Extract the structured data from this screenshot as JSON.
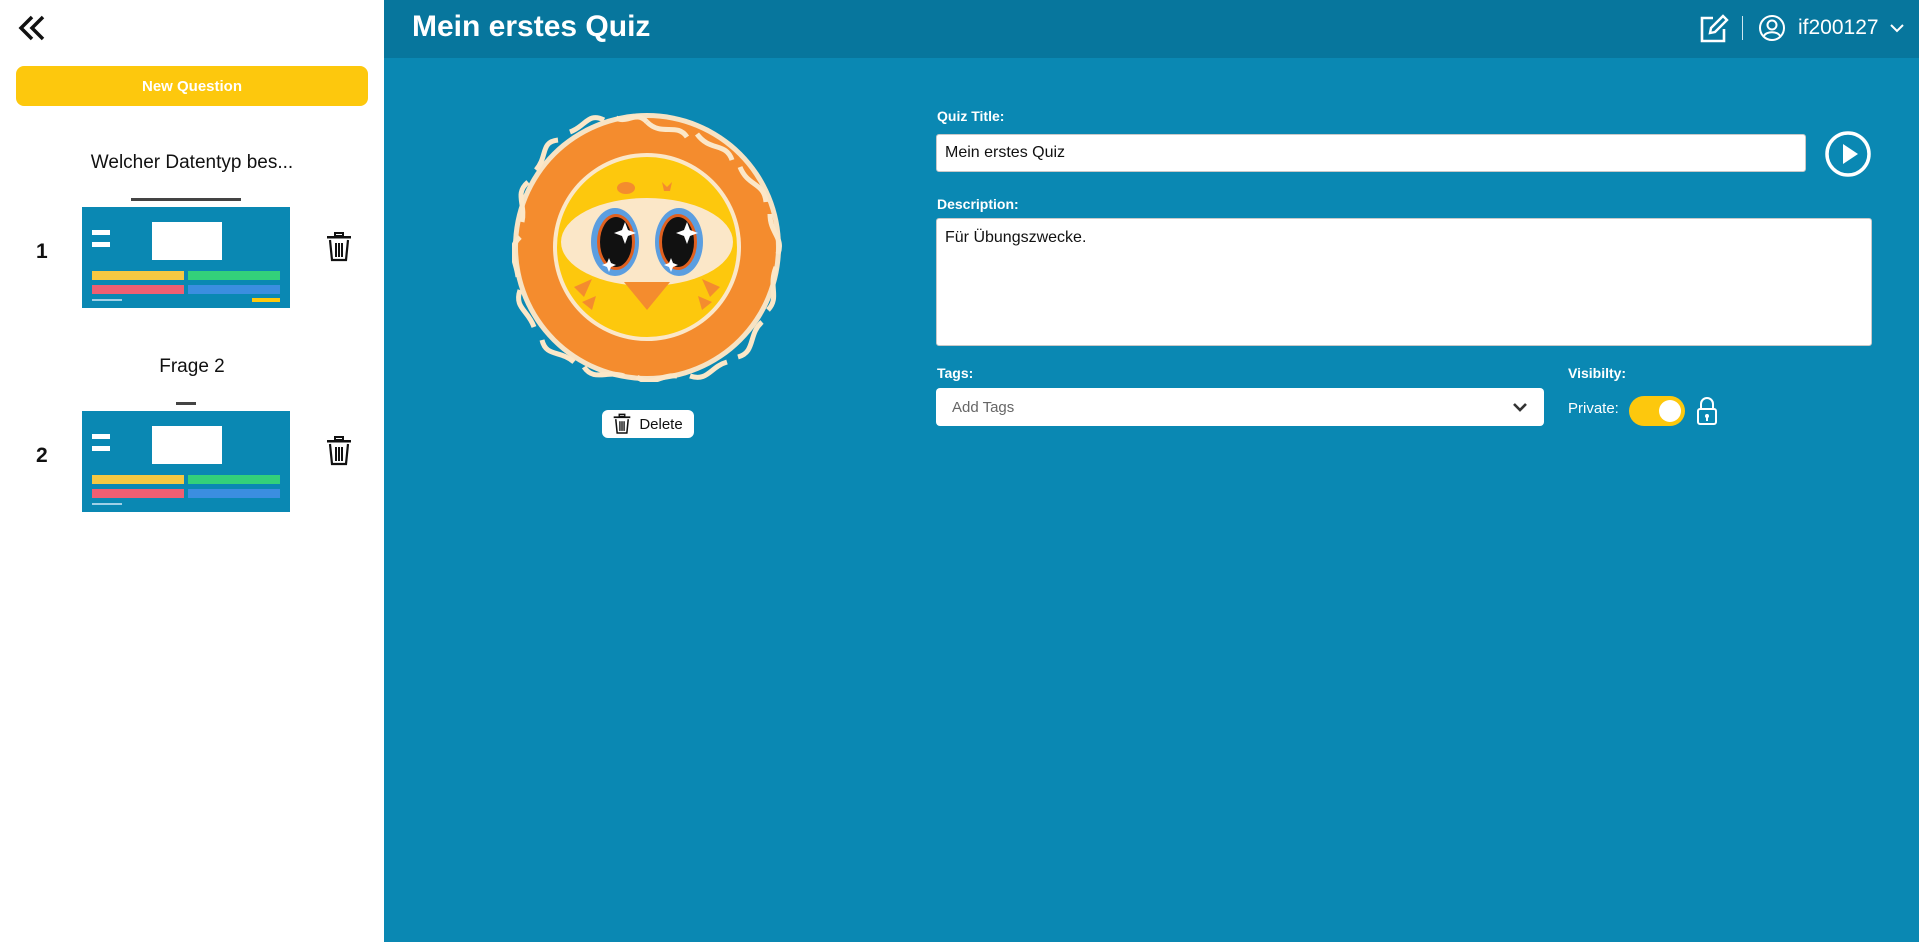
{
  "sidebar": {
    "new_question_label": "New Question",
    "questions": [
      {
        "number": "1",
        "title": "Welcher Datentyp bes...",
        "thumb_answers": [
          "#f5c842",
          "#33d17a",
          "#ef5f72",
          "#3b8ee0"
        ]
      },
      {
        "number": "2",
        "title": "Frage 2",
        "thumb_answers": [
          "#f5c842",
          "#33d17a",
          "#ef5f72",
          "#3b8ee0"
        ]
      }
    ]
  },
  "header": {
    "title": "Mein erstes Quiz",
    "username": "if200127"
  },
  "quiz": {
    "delete_label": "Delete",
    "title_label": "Quiz Title:",
    "title_value": "Mein erstes Quiz",
    "description_label": "Description:",
    "description_value": "Für Übungszwecke.",
    "tags_label": "Tags:",
    "tags_placeholder": "Add Tags",
    "visibility_label": "Visibilty:",
    "private_label": "Private:",
    "private_on": true
  },
  "icons": {
    "collapse": "double-chevron-left-icon",
    "trash": "trash-icon",
    "edit": "edit-icon",
    "user": "user-circle-icon",
    "chevron": "chevron-down-icon",
    "play": "play-circle-icon",
    "lock": "lock-icon"
  },
  "colors": {
    "accent_yellow": "#fdc80d",
    "main_bg": "#0a88b3",
    "header_bg": "#07769d"
  }
}
